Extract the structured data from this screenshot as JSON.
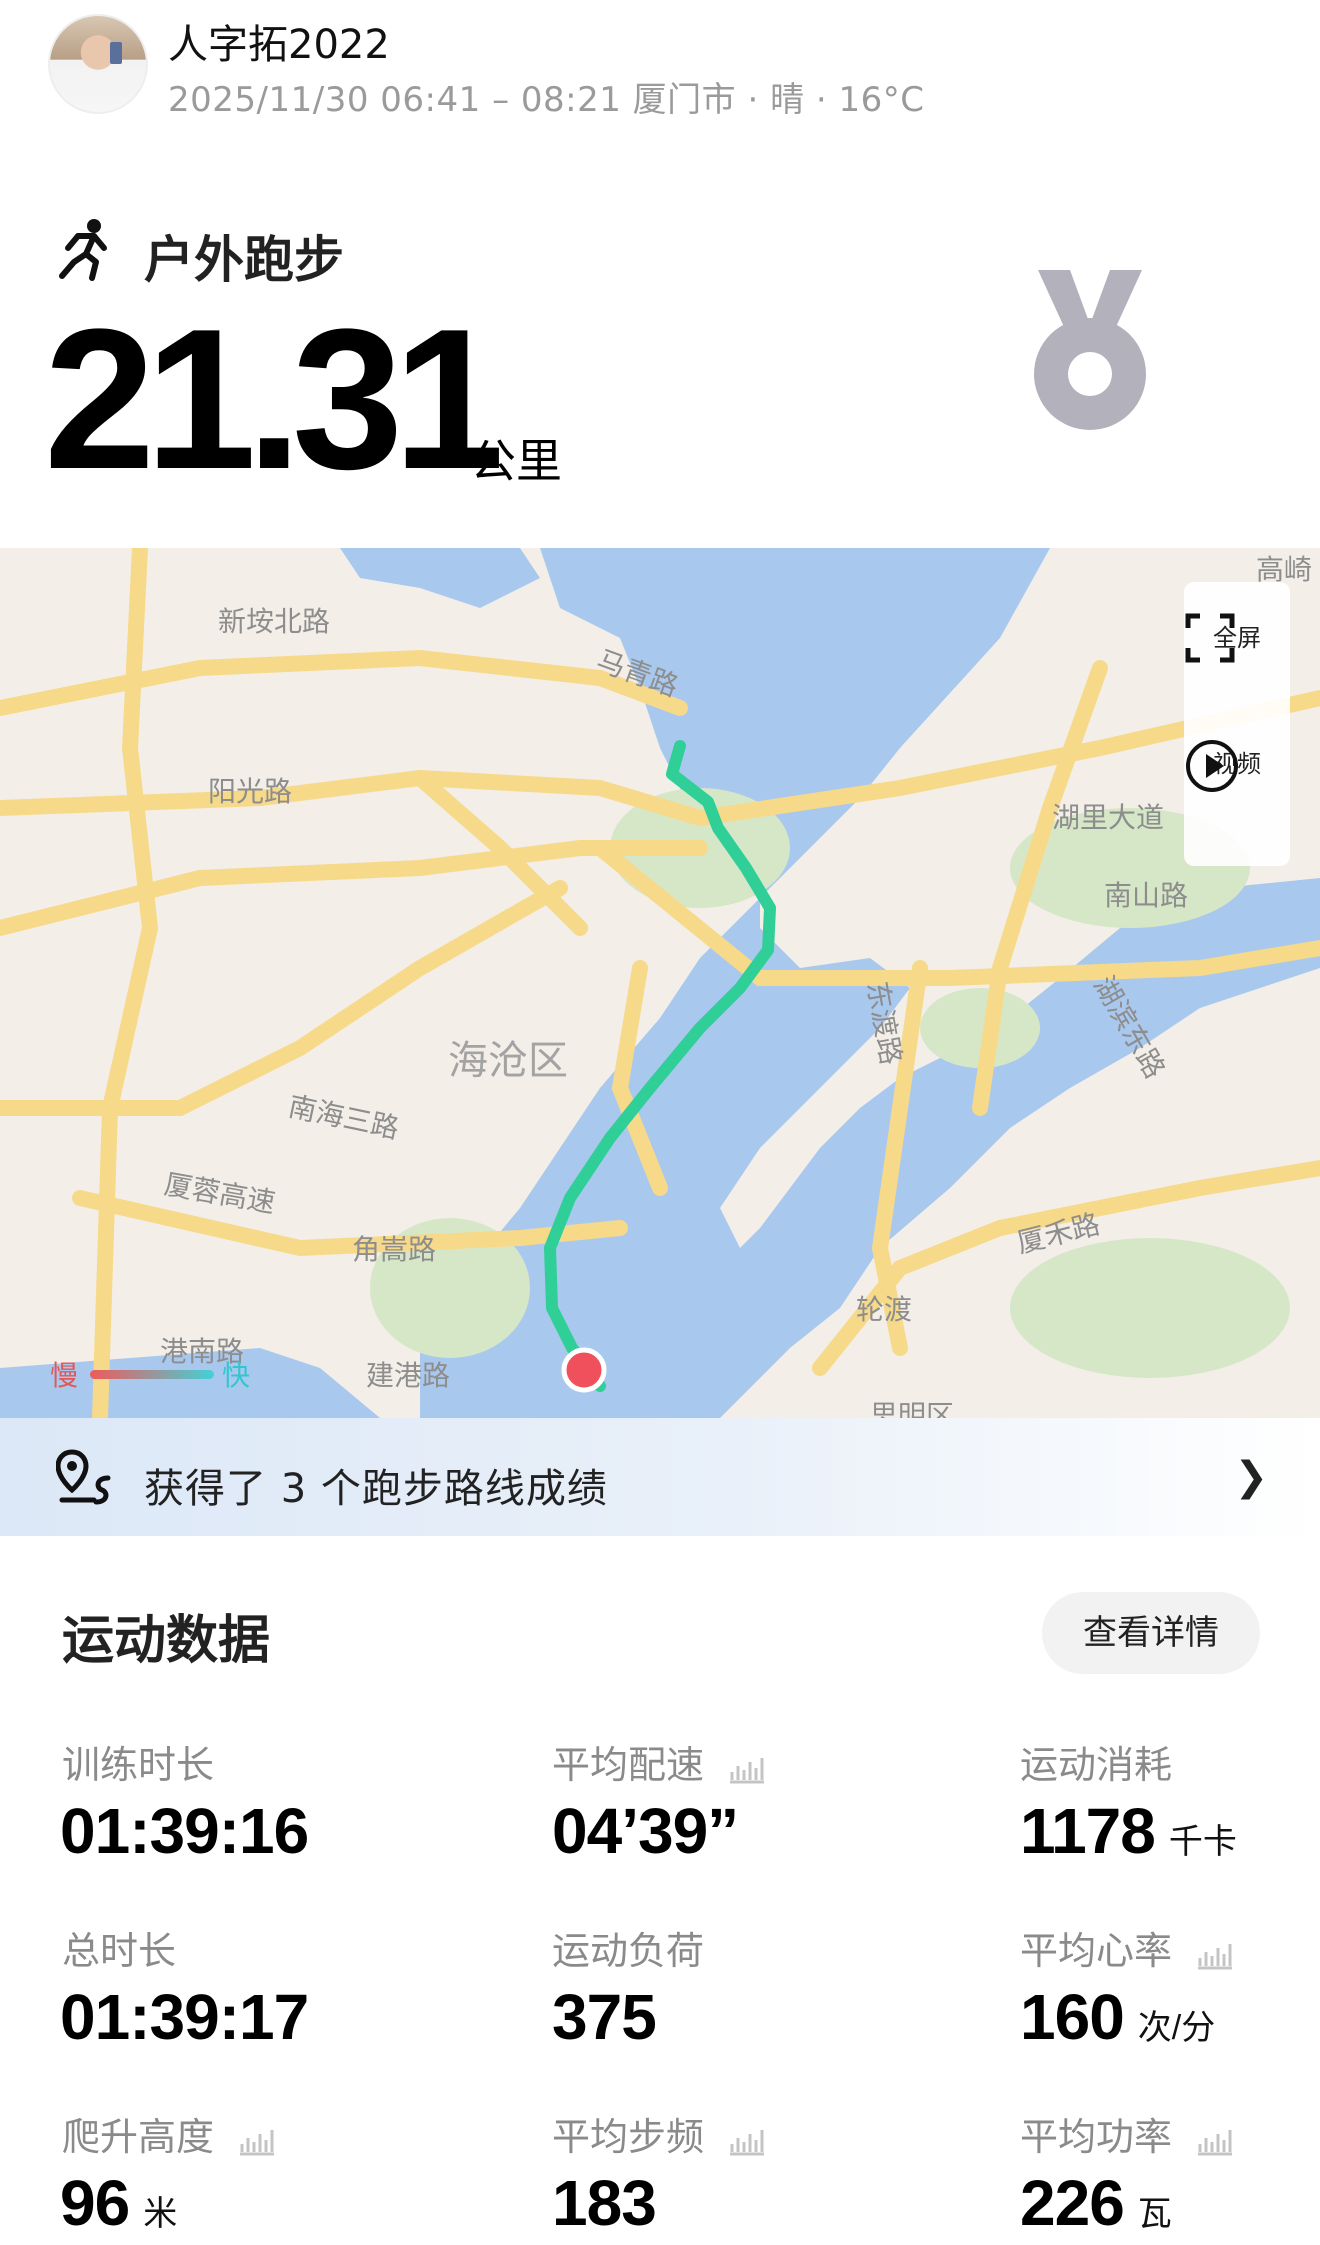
{
  "header": {
    "user_name": "人字拓2022",
    "meta": "2025/11/30 06:41 – 08:21 厦门市 · 晴 · 16°C"
  },
  "activity": {
    "type_label": "户外跑步",
    "distance": "21.31",
    "distance_unit": "公里"
  },
  "map": {
    "labels": {
      "xinan_north": "新垵北路",
      "maqing": "马青路",
      "yangguang": "阳光路",
      "huli": "湖里大道",
      "nanshan": "南山路",
      "dongdu": "东渡路",
      "hubin": "湖滨东路",
      "haicang": "海沧区",
      "nanhai": "南海三路",
      "xiarong": "厦蓉高速",
      "jiaosong": "角嵩路",
      "xiahe": "厦禾路",
      "lundu": "轮渡",
      "gangnan": "港南路",
      "jiangang": "建港路",
      "gaoqi": "高崎",
      "siming": "思明区"
    },
    "fullscreen_label": "全屏",
    "video_label": "视频",
    "legend_slow": "慢",
    "legend_fast": "快"
  },
  "route_banner": {
    "text": "获得了 3 个跑步路线成绩"
  },
  "stats": {
    "title": "运动数据",
    "details_button": "查看详情",
    "items": [
      {
        "label": "训练时长",
        "value": "01:39:16",
        "unit": ""
      },
      {
        "label": "平均配速",
        "value": "04’39”",
        "unit": ""
      },
      {
        "label": "运动消耗",
        "value": "1178",
        "unit": "千卡"
      },
      {
        "label": "总时长",
        "value": "01:39:17",
        "unit": ""
      },
      {
        "label": "运动负荷",
        "value": "375",
        "unit": ""
      },
      {
        "label": "平均心率",
        "value": "160",
        "unit": "次/分"
      },
      {
        "label": "爬升高度",
        "value": "96",
        "unit": "米"
      },
      {
        "label": "平均步频",
        "value": "183",
        "unit": ""
      },
      {
        "label": "平均功率",
        "value": "226",
        "unit": "瓦"
      }
    ]
  },
  "colors": {
    "route": "#2fcf97",
    "water": "#a9c8ee",
    "road": "#f7d98a",
    "medal": "#b3b1bc"
  }
}
